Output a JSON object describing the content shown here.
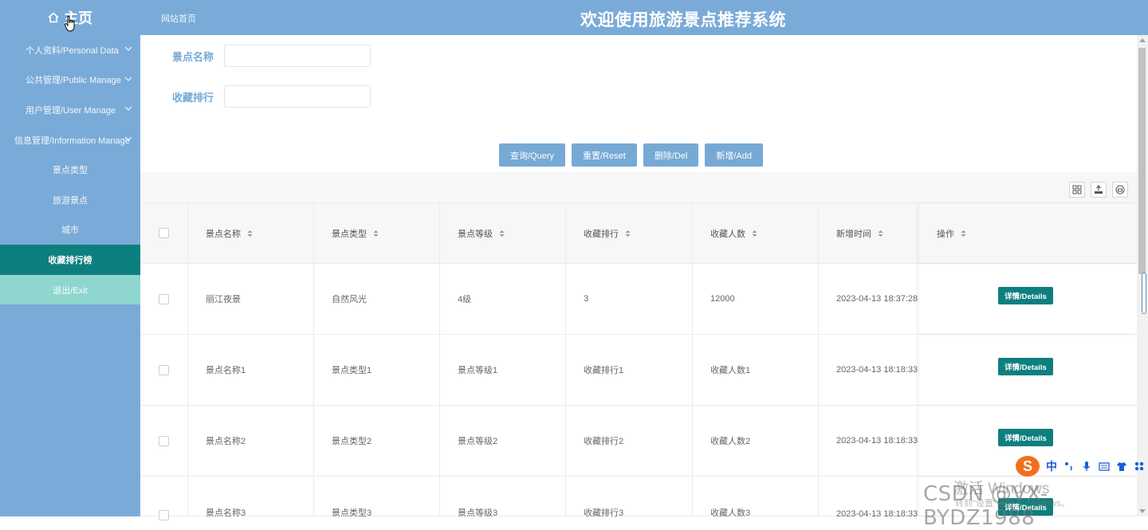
{
  "header": {
    "home_label": "主页",
    "site_link": "网站首页",
    "title": "欢迎使用旅游景点推荐系统"
  },
  "sidebar": {
    "items": [
      {
        "label": "个人资料/Personal Data",
        "has_chevron": true
      },
      {
        "label": "公共管理/Public Manage",
        "has_chevron": true
      },
      {
        "label": "用户管理/User Manage",
        "has_chevron": true
      },
      {
        "label": "信息管理/Information Manage",
        "has_chevron": true
      },
      {
        "label": "景点类型"
      },
      {
        "label": "旅游景点"
      },
      {
        "label": "城市"
      },
      {
        "label": "收藏排行榜",
        "active": true
      },
      {
        "label": "退出/Exit"
      }
    ]
  },
  "search": {
    "name_label": "景点名称",
    "name_value": "",
    "rank_label": "收藏排行",
    "rank_value": ""
  },
  "actions": {
    "query": "查询/Query",
    "reset": "重置/Reset",
    "delete": "删除/Del",
    "add": "新增/Add"
  },
  "table": {
    "headers": [
      "景点名称",
      "景点类型",
      "景点等级",
      "收藏排行",
      "收藏人数",
      "新增时间",
      "操作"
    ],
    "rows": [
      {
        "name": "丽江夜景",
        "type": "自然风光",
        "level": "4级",
        "rank": "3",
        "count": "12000",
        "time": "2023-04-13 18:37:28"
      },
      {
        "name": "景点名称1",
        "type": "景点类型1",
        "level": "景点等级1",
        "rank": "收藏排行1",
        "count": "收藏人数1",
        "time": "2023-04-13 18:18:33"
      },
      {
        "name": "景点名称2",
        "type": "景点类型2",
        "level": "景点等级2",
        "rank": "收藏排行2",
        "count": "收藏人数2",
        "time": "2023-04-13 18:18:33"
      },
      {
        "name": "景点名称3",
        "type": "景点类型3",
        "level": "景点等级3",
        "rank": "收藏排行3",
        "count": "收藏人数3",
        "time": "2023-04-13 18:18:33"
      }
    ],
    "detail_label": "详情/Details"
  },
  "ime": {
    "lang": "中"
  },
  "overlay": {
    "activate_windows": "激活 Windows",
    "activate_hint": "转到\"设置\"以激活 Windows。",
    "csdn": "CSDN @VX-BYDZ1988"
  },
  "colors": {
    "primary": "#7aabd8",
    "active": "#0e7f7f",
    "exit": "#8fd6ce"
  }
}
